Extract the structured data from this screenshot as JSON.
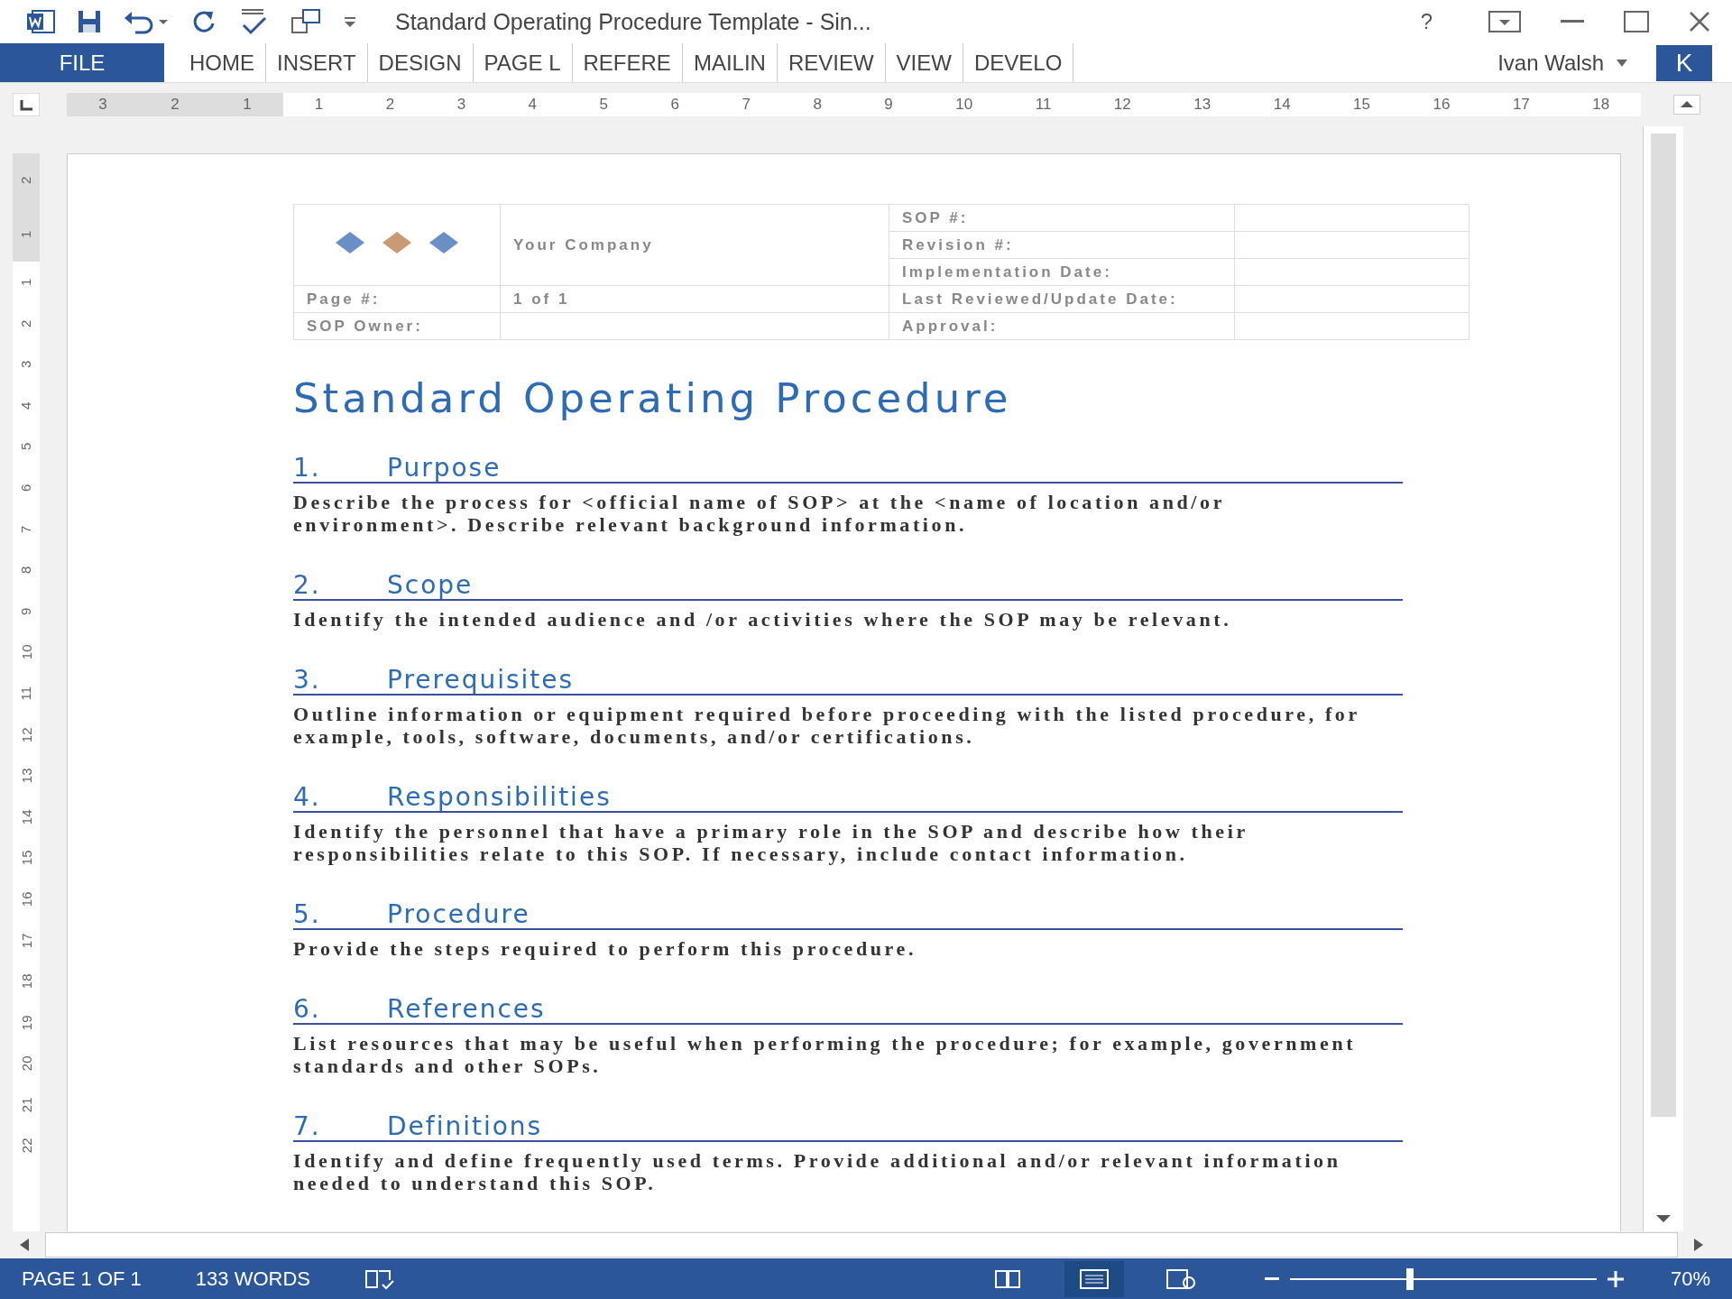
{
  "window": {
    "title": "Standard Operating Procedure Template - Sin...",
    "help": "?"
  },
  "ribbon": {
    "tabs": [
      {
        "label": "FILE",
        "selected": true
      },
      {
        "label": "HOME",
        "selected": false
      },
      {
        "label": "INSERT",
        "selected": false
      },
      {
        "label": "DESIGN",
        "selected": false
      },
      {
        "label": "PAGE L",
        "selected": false
      },
      {
        "label": "REFERE",
        "selected": false
      },
      {
        "label": "MAILIN",
        "selected": false
      },
      {
        "label": "REVIEW",
        "selected": false
      },
      {
        "label": "VIEW",
        "selected": false
      },
      {
        "label": "DEVELO",
        "selected": false
      }
    ],
    "user": "Ivan Walsh",
    "avatar": "K"
  },
  "ruler": {
    "left_numbers": [
      "3",
      "2",
      "1"
    ],
    "right_numbers": [
      "1",
      "2",
      "3",
      "4",
      "5",
      "6",
      "7",
      "8",
      "9",
      "10",
      "11",
      "12",
      "13",
      "14",
      "15",
      "16",
      "17",
      "18"
    ]
  },
  "vertical_ruler": {
    "top_numbers": [
      "2",
      "1"
    ],
    "numbers": [
      "1",
      "2",
      "3",
      "4",
      "5",
      "6",
      "7",
      "8",
      "9",
      "10",
      "11",
      "12",
      "13",
      "14",
      "15",
      "16",
      "17",
      "18",
      "19",
      "20",
      "21",
      "22"
    ]
  },
  "header_table": {
    "company": "Your Company",
    "rows": [
      {
        "label": "Page #:",
        "value": "1 of 1"
      },
      {
        "label": "SOP Owner:",
        "value": ""
      }
    ],
    "fields": [
      "SOP #:",
      "Revision #:",
      "Implementation Date:",
      "Last Reviewed/Update Date:",
      "Approval:"
    ]
  },
  "document": {
    "title": "Standard Operating Procedure",
    "sections": [
      {
        "number": "1.",
        "heading": "Purpose",
        "body": "Describe the process for <official name of SOP> at the <name of location and/or environment>. Describe relevant background information."
      },
      {
        "number": "2.",
        "heading": "Scope",
        "body": "Identify the intended audience and /or activities where the SOP may be relevant."
      },
      {
        "number": "3.",
        "heading": "Prerequisites",
        "body": "Outline information or equipment required before proceeding with the listed procedure, for example, tools, software, documents, and/or certifications."
      },
      {
        "number": "4.",
        "heading": "Responsibilities",
        "body": "Identify the personnel that have a primary role in the SOP and describe how their responsibilities relate to this SOP.  If necessary, include contact information."
      },
      {
        "number": "5.",
        "heading": "Procedure",
        "body": "Provide the steps required to perform this procedure."
      },
      {
        "number": "6.",
        "heading": "References",
        "body": "List resources that may be useful when performing the procedure; for example, government standards and other SOPs."
      },
      {
        "number": "7.",
        "heading": "Definitions",
        "body": "Identify and define frequently used terms. Provide additional and/or relevant information needed to understand this SOP."
      }
    ]
  },
  "status_bar": {
    "page": "PAGE 1 OF 1",
    "words": "133 WORDS",
    "views": [
      {
        "kind": "read",
        "selected": false
      },
      {
        "kind": "print",
        "selected": true
      },
      {
        "kind": "web",
        "selected": false
      }
    ],
    "zoom": {
      "level": 0.38,
      "reading": "70%"
    }
  }
}
